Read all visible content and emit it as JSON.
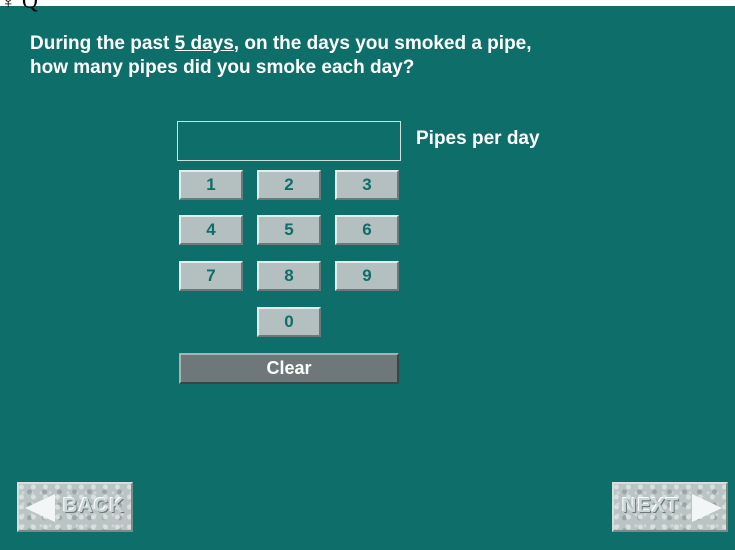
{
  "header": {
    "partial_glyph": "♀ Q"
  },
  "question": {
    "before": "During the past ",
    "emphasis": "5 days",
    "after": ", on the days you smoked a pipe,",
    "line2": "how many pipes did you smoke each day?"
  },
  "entry": {
    "value": "",
    "unit_label": "Pipes per day"
  },
  "keypad": {
    "keys": [
      "1",
      "2",
      "3",
      "4",
      "5",
      "6",
      "7",
      "8",
      "9",
      "0"
    ],
    "clear_label": "Clear"
  },
  "navigation": {
    "back_label": "BACK",
    "next_label": "NEXT"
  },
  "colors": {
    "background": "#0e6e6a",
    "key_face": "#b4bfbf",
    "key_text": "#0e6e6a",
    "clear_face": "#6e7878",
    "text": "#ffffff"
  }
}
